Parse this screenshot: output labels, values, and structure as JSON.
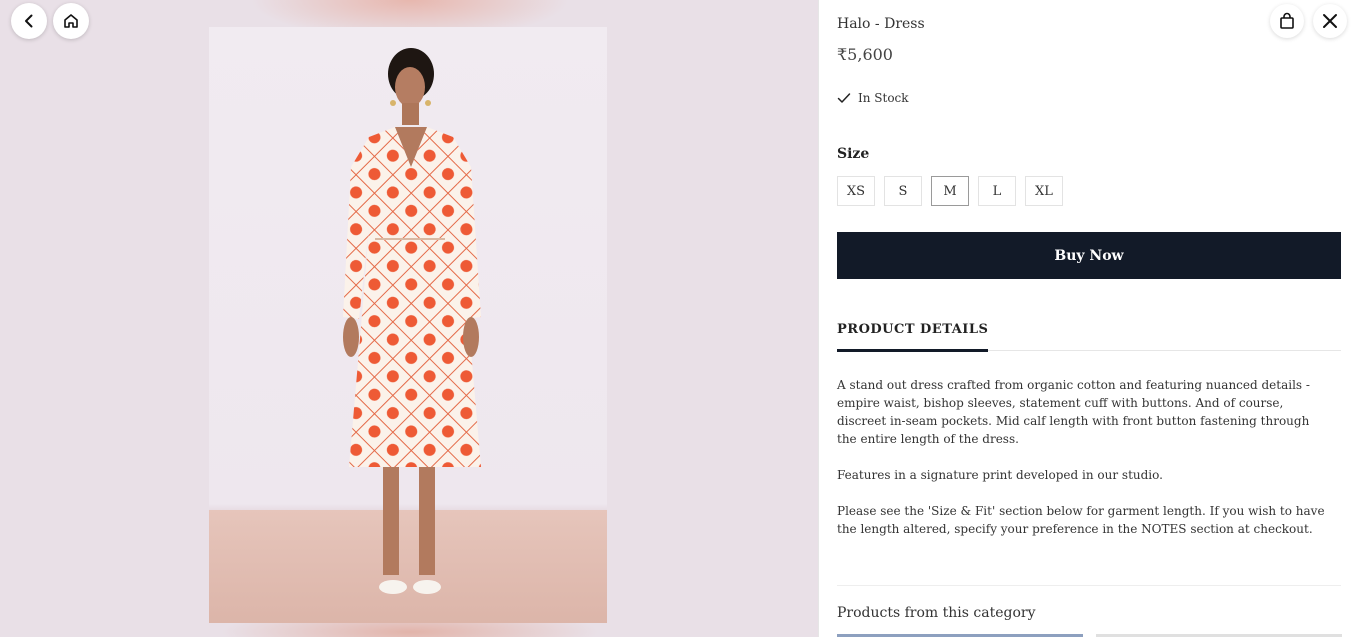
{
  "product": {
    "title": "Halo - Dress",
    "price": "₹5,600",
    "stock": "In Stock"
  },
  "size": {
    "label": "Size",
    "options": [
      "XS",
      "S",
      "M",
      "L",
      "XL"
    ],
    "selected": "M"
  },
  "buy_label": "Buy Now",
  "tabs": {
    "details": "PRODUCT DETAILS"
  },
  "description": {
    "p1": "A stand out dress crafted from organic cotton and featuring nuanced details - empire waist, bishop sleeves, statement cuff with buttons. And of course, discreet in-seam pockets. Mid calf length with front button fastening through the entire length of the dress.",
    "p2": "Features in a signature print developed in our studio.",
    "p3": "Please see the 'Size & Fit' section below for garment length. If you wish to have the length altered, specify your preference in the NOTES section at checkout."
  },
  "category_label": "Products from this category",
  "colors": {
    "buy_button": "#121a28",
    "print_orange": "#ee5a35",
    "dress_base": "#fbf2ea"
  },
  "icons": {
    "back": "chevron-left-icon",
    "home": "home-icon",
    "bag": "shopping-bag-icon",
    "close": "close-icon",
    "stock": "check-icon"
  }
}
